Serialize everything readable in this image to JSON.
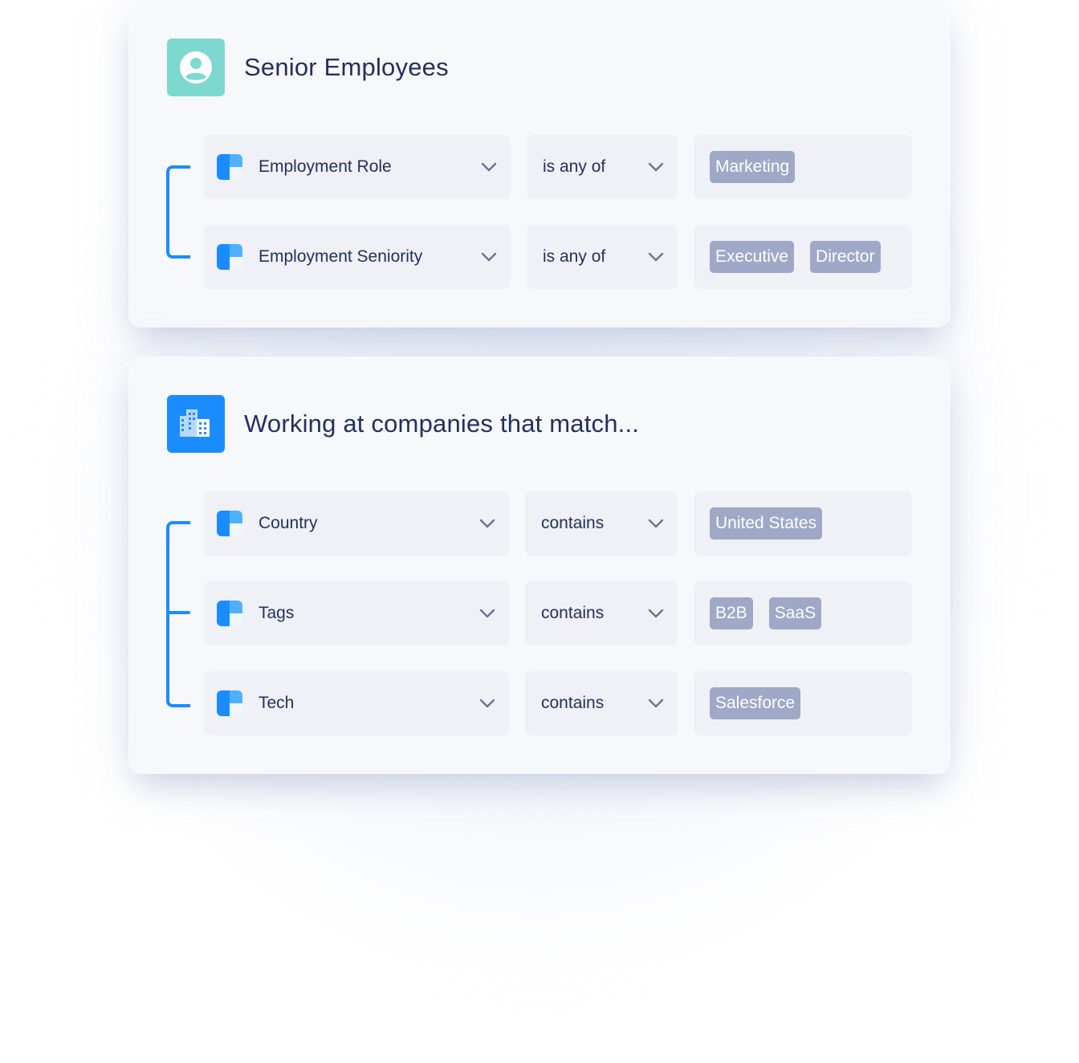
{
  "groups": [
    {
      "title": "Senior Employees",
      "icon": "user-circle-icon",
      "icon_color": "#7dd9d0",
      "conditions": [
        {
          "field": "Employment Role",
          "operator": "is any of",
          "values": [
            "Marketing"
          ]
        },
        {
          "field": "Employment Seniority",
          "operator": "is any of",
          "values": [
            "Executive",
            "Director"
          ]
        }
      ]
    },
    {
      "title": "Working at companies that match...",
      "icon": "buildings-icon",
      "icon_color": "#1a8cff",
      "conditions": [
        {
          "field": "Country",
          "operator": "contains",
          "values": [
            "United States"
          ]
        },
        {
          "field": "Tags",
          "operator": "contains",
          "values": [
            "B2B",
            "SaaS"
          ]
        },
        {
          "field": "Tech",
          "operator": "contains",
          "values": [
            "Salesforce"
          ]
        }
      ]
    }
  ],
  "colors": {
    "accent": "#1a8cff",
    "chip": "#9fa8c7",
    "title_text": "#242f5e",
    "field_bg": "#eff1f6"
  }
}
